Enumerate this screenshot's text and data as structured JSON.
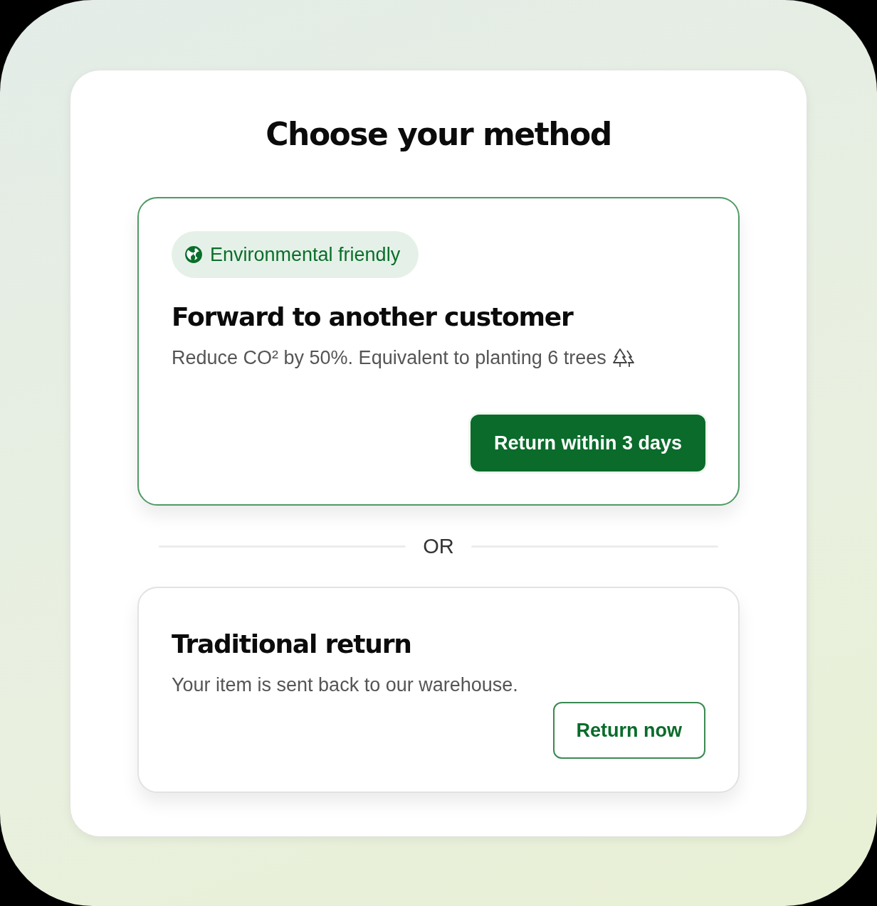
{
  "title": "Choose your method",
  "options": [
    {
      "badge": "Environmental friendly",
      "heading": "Forward to another customer",
      "description": "Reduce CO² by 50%. Equivalent to planting 6 trees",
      "trees_icon": true,
      "button": {
        "label": "Return within 3 days",
        "kind": "primary"
      },
      "highlighted": true
    },
    {
      "heading": "Traditional return",
      "description": "Your item is sent back to our warehouse.",
      "trees_icon": false,
      "button": {
        "label": "Return now",
        "kind": "outline"
      },
      "highlighted": false
    }
  ],
  "separator": "OR"
}
